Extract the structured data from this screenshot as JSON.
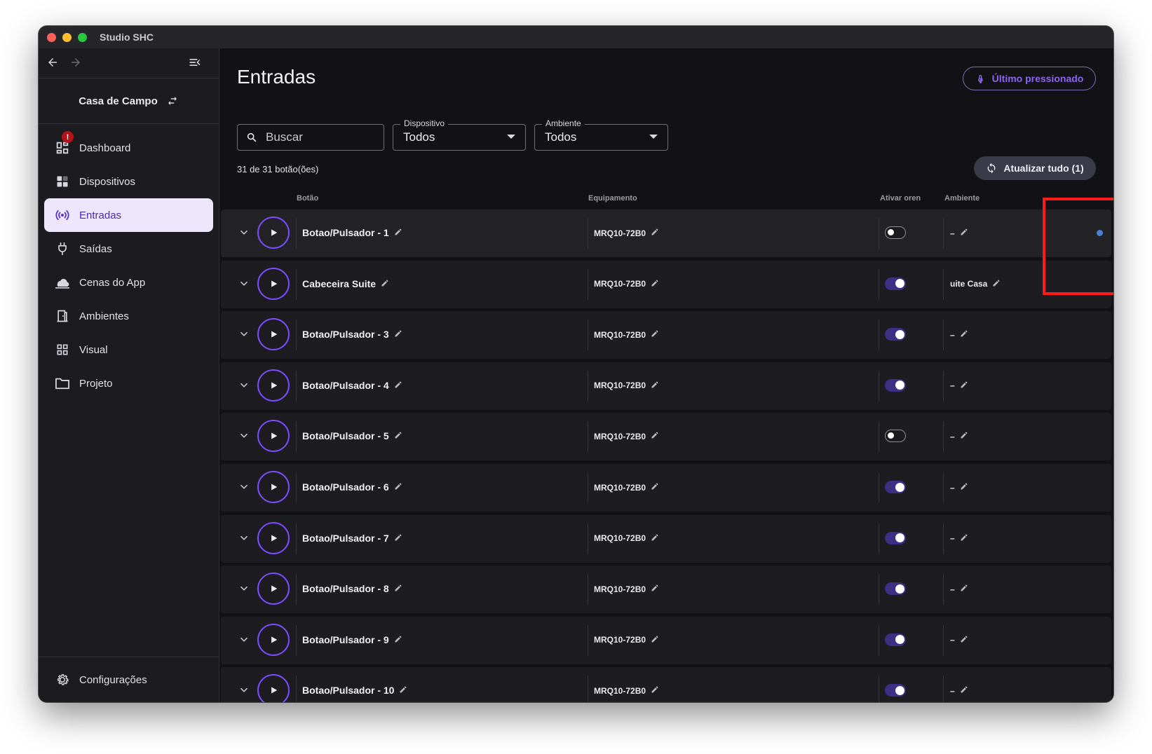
{
  "window": {
    "title": "Studio SHC"
  },
  "colors": {
    "accent": "#7c4dff",
    "active_nav_bg": "#ede6fc",
    "highlight": "#ff1a1a",
    "status_dot": "#4a7fd4"
  },
  "sidebar": {
    "workspace": "Casa de Campo",
    "badge": "!",
    "items": [
      {
        "label": "Dashboard",
        "icon": "dashboard-icon",
        "active": false
      },
      {
        "label": "Dispositivos",
        "icon": "devices-icon",
        "active": false
      },
      {
        "label": "Entradas",
        "icon": "broadcast-icon",
        "active": true
      },
      {
        "label": "Saídas",
        "icon": "plug-icon",
        "active": false
      },
      {
        "label": "Cenas do App",
        "icon": "cloud-icon",
        "active": false
      },
      {
        "label": "Ambientes",
        "icon": "door-icon",
        "active": false
      },
      {
        "label": "Visual",
        "icon": "grid-icon",
        "active": false
      },
      {
        "label": "Projeto",
        "icon": "folder-icon",
        "active": false
      }
    ],
    "settings": "Configurações"
  },
  "main": {
    "title": "Entradas",
    "last_pressed": "Último pressionado",
    "search_placeholder": "Buscar",
    "device_filter": {
      "label": "Dispositivo",
      "value": "Todos"
    },
    "room_filter": {
      "label": "Ambiente",
      "value": "Todos"
    },
    "count": "31 de 31 botão(ões)",
    "refresh_all": "Atualizar tudo (1)",
    "columns": {
      "button": "Botão",
      "equipment": "Equipamento",
      "enable": "Ativar oren",
      "room": "Ambiente"
    }
  },
  "rows": [
    {
      "name": "Botao/Pulsador - 1",
      "equipment": "MRQ10-72B0",
      "enabled": false,
      "room": "–"
    },
    {
      "name": "Cabeceira Suite",
      "equipment": "MRQ10-72B0",
      "enabled": true,
      "room": "uite Casa"
    },
    {
      "name": "Botao/Pulsador - 3",
      "equipment": "MRQ10-72B0",
      "enabled": true,
      "room": "–"
    },
    {
      "name": "Botao/Pulsador - 4",
      "equipment": "MRQ10-72B0",
      "enabled": true,
      "room": "–"
    },
    {
      "name": "Botao/Pulsador - 5",
      "equipment": "MRQ10-72B0",
      "enabled": false,
      "room": "–"
    },
    {
      "name": "Botao/Pulsador - 6",
      "equipment": "MRQ10-72B0",
      "enabled": true,
      "room": "–"
    },
    {
      "name": "Botao/Pulsador - 7",
      "equipment": "MRQ10-72B0",
      "enabled": true,
      "room": "–"
    },
    {
      "name": "Botao/Pulsador - 8",
      "equipment": "MRQ10-72B0",
      "enabled": true,
      "room": "–"
    },
    {
      "name": "Botao/Pulsador - 9",
      "equipment": "MRQ10-72B0",
      "enabled": true,
      "room": "–"
    },
    {
      "name": "Botao/Pulsador - 10",
      "equipment": "MRQ10-72B0",
      "enabled": true,
      "room": "–"
    }
  ]
}
